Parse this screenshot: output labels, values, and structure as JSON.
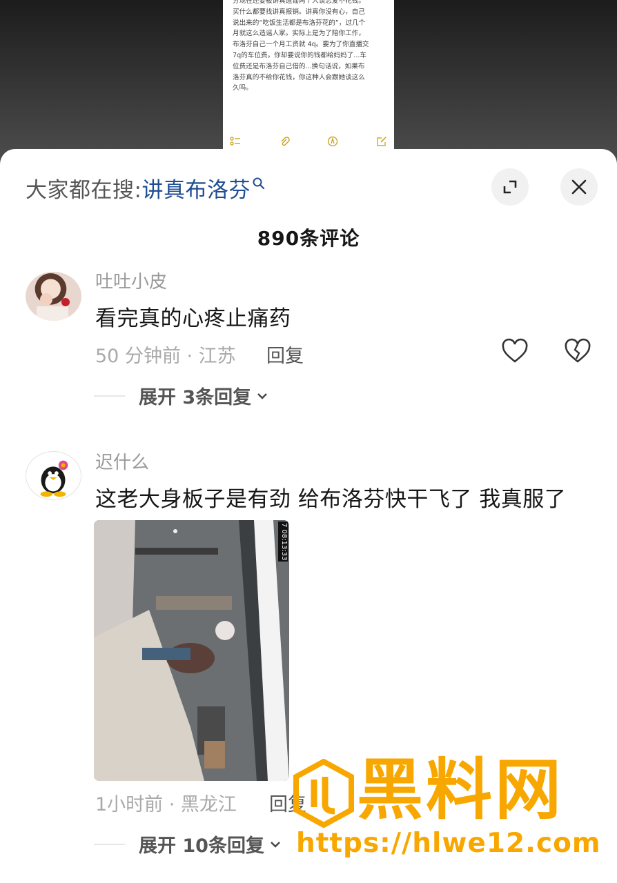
{
  "background_doc": {
    "text": "分现在还要被讲真造谣两个人谈恋爱不花钱。\n买什么都要找讲真报销。讲真你没有心，自己\n说出来的“吃饭生活都是布洛芬花的”，过几个\n月就这么造谣人家。实际上是为了陪你工作，\n布洛芬自己一个月工资就 4q。要为了你直播交\n7q的车位费。你却要说你的钱都给妈妈了...车\n位费还是布洛芬自己借的...换句话说，如果布\n洛芬真的不给你花钱，你这种人会跟她谈这么\n久吗。",
    "toolbar_icons": [
      "checklist-icon",
      "attachment-icon",
      "markup-icon",
      "compose-icon"
    ]
  },
  "sheet": {
    "search_prefix": "大家都在搜:",
    "search_keyword": "讲真布洛芬",
    "comment_count": "890条评论"
  },
  "comments": [
    {
      "username": "吐吐小皮",
      "text": "看完真的心疼止痛药",
      "meta": "50 分钟前 · 江苏",
      "reply_label": "回复",
      "expand_label": "展开 3条回复"
    },
    {
      "username": "迟什么",
      "text": "这老大身板子是有劲 给布洛芬快干飞了 我真服了",
      "meta": "1小时前 · 黑龙江",
      "reply_label": "回复",
      "photo_timestamp": "7 08:13:33",
      "expand_label": "展开 10条回复"
    }
  ],
  "watermark": {
    "logo_text": "黑料网",
    "url": "https://hlwe12.com"
  },
  "colors": {
    "keyword": "#1f4e92",
    "watermark": "#f7a700"
  }
}
